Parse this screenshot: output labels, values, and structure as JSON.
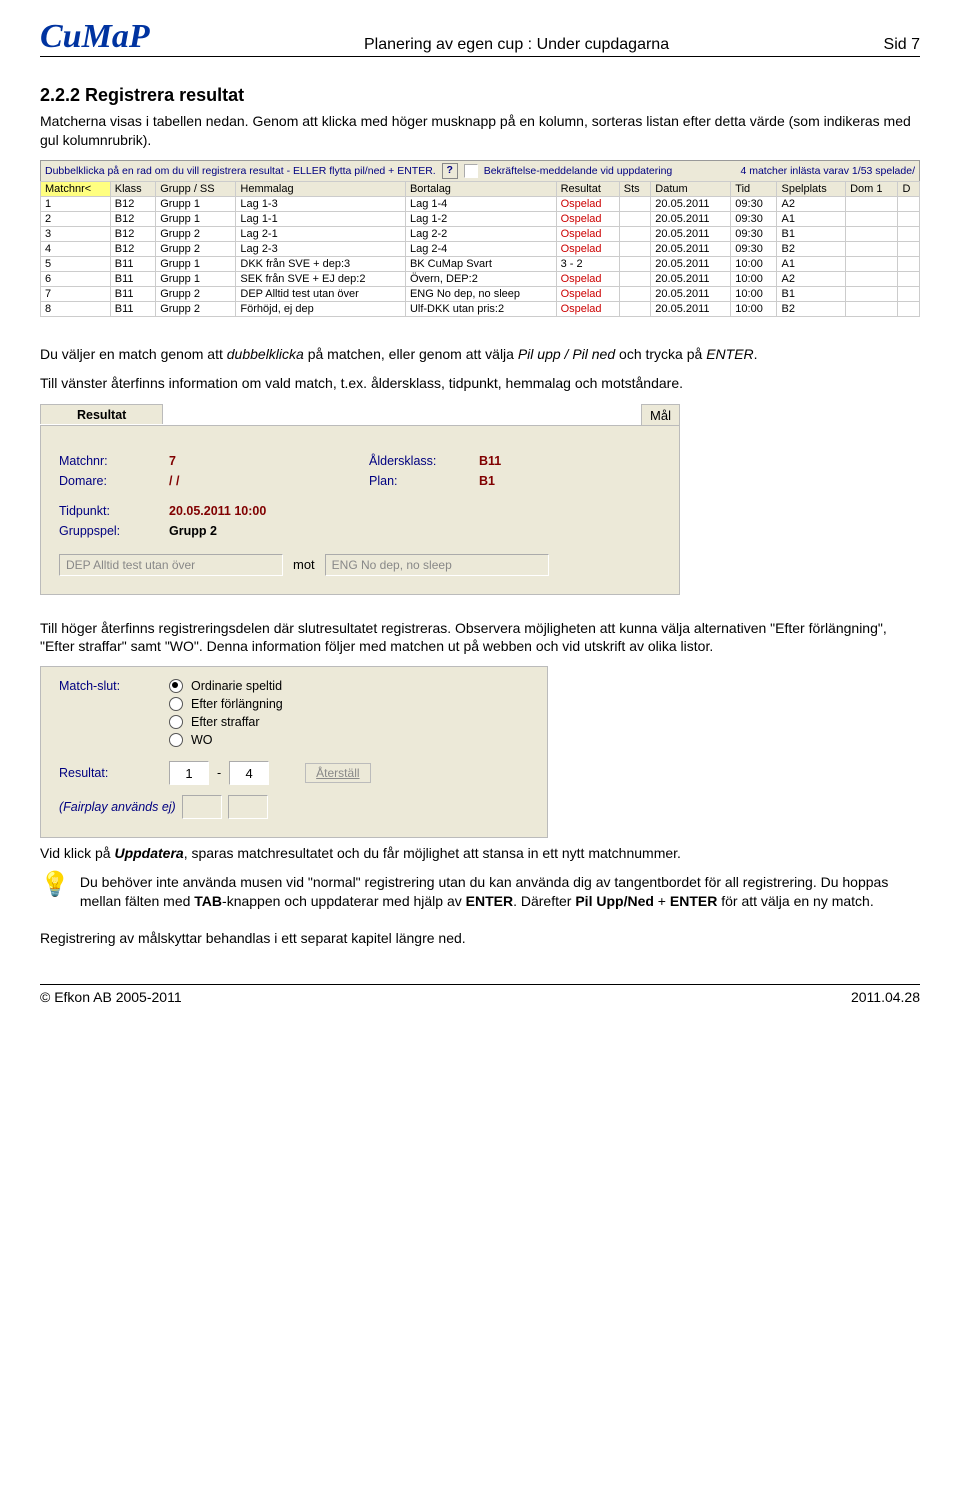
{
  "header": {
    "logo_text": "CuMaP",
    "center": "Planering av egen cup : Under cupdagarna",
    "page": "Sid 7"
  },
  "section": {
    "heading": "2.2.2 Registrera resultat",
    "intro": "Matcherna visas i tabellen nedan. Genom att klicka med höger musknapp på en kolumn, sorteras listan efter detta värde (som indikeras med gul kolumnrubrik)."
  },
  "table_hint": {
    "left": "Dubbelklicka på en rad om du vill registrera resultat - ELLER flytta pil/ned + ENTER.",
    "checkbox_label": "Bekräftelse-meddelande vid uppdatering",
    "right": "4 matcher inlästa varav 1/53 spelade/"
  },
  "table": {
    "columns": [
      "Matchnr<",
      "Klass",
      "Grupp / SS",
      "Hemmalag",
      "Bortalag",
      "Resultat",
      "Sts",
      "Datum",
      "Tid",
      "Spelplats",
      "Dom 1",
      "D"
    ],
    "rows": [
      {
        "nr": "1",
        "klass": "B12",
        "grupp": "Grupp 1",
        "hem": "Lag 1-3",
        "bort": "Lag 1-4",
        "res": "Ospelad",
        "sts": "",
        "datum": "20.05.2011",
        "tid": "09:30",
        "plats": "A2",
        "d1": "",
        "d2": ""
      },
      {
        "nr": "2",
        "klass": "B12",
        "grupp": "Grupp 1",
        "hem": "Lag 1-1",
        "bort": "Lag 1-2",
        "res": "Ospelad",
        "sts": "",
        "datum": "20.05.2011",
        "tid": "09:30",
        "plats": "A1",
        "d1": "",
        "d2": ""
      },
      {
        "nr": "3",
        "klass": "B12",
        "grupp": "Grupp 2",
        "hem": "Lag 2-1",
        "bort": "Lag 2-2",
        "res": "Ospelad",
        "sts": "",
        "datum": "20.05.2011",
        "tid": "09:30",
        "plats": "B1",
        "d1": "",
        "d2": ""
      },
      {
        "nr": "4",
        "klass": "B12",
        "grupp": "Grupp 2",
        "hem": "Lag 2-3",
        "bort": "Lag 2-4",
        "res": "Ospelad",
        "sts": "",
        "datum": "20.05.2011",
        "tid": "09:30",
        "plats": "B2",
        "d1": "",
        "d2": ""
      },
      {
        "nr": "5",
        "klass": "B11",
        "grupp": "Grupp 1",
        "hem": "DKK från SVE + dep:3",
        "bort": "BK CuMap Svart",
        "res": "3 - 2",
        "sts": "",
        "datum": "20.05.2011",
        "tid": "10:00",
        "plats": "A1",
        "d1": "",
        "d2": ""
      },
      {
        "nr": "6",
        "klass": "B11",
        "grupp": "Grupp 1",
        "hem": "SEK från SVE + EJ dep:2",
        "bort": "Övern, DEP:2",
        "res": "Ospelad",
        "sts": "",
        "datum": "20.05.2011",
        "tid": "10:00",
        "plats": "A2",
        "d1": "",
        "d2": ""
      },
      {
        "nr": "7",
        "klass": "B11",
        "grupp": "Grupp 2",
        "hem": "DEP Alltid test utan över",
        "bort": "ENG No dep, no sleep",
        "res": "Ospelad",
        "sts": "",
        "datum": "20.05.2011",
        "tid": "10:00",
        "plats": "B1",
        "d1": "",
        "d2": ""
      },
      {
        "nr": "8",
        "klass": "B11",
        "grupp": "Grupp 2",
        "hem": "Förhöjd, ej dep",
        "bort": "Ulf-DKK utan pris:2",
        "res": "Ospelad",
        "sts": "",
        "datum": "20.05.2011",
        "tid": "10:00",
        "plats": "B2",
        "d1": "",
        "d2": ""
      }
    ]
  },
  "para1": "Du väljer en match genom att dubbelklicka på matchen, eller genom att välja Pil upp / Pil ned och trycka på ENTER.",
  "para2": "Till vänster återfinns information om vald match, t.ex. åldersklass, tidpunkt, hemmalag och motståndare.",
  "resultat_panel": {
    "tab_main": "Resultat",
    "tab_right": "Mål",
    "labels": {
      "matchnr": "Matchnr:",
      "domare": "Domare:",
      "aldersklass": "Åldersklass:",
      "plan": "Plan:",
      "tidpunkt": "Tidpunkt:",
      "gruppspel": "Gruppspel:"
    },
    "values": {
      "matchnr": "7",
      "domare": "/ /",
      "aldersklass": "B11",
      "plan": "B1",
      "tidpunkt": "20.05.2011 10:00",
      "gruppspel": "Grupp 2",
      "home_team": "DEP Alltid test utan över",
      "mot": "mot",
      "away_team": "ENG No dep, no sleep"
    }
  },
  "para3": "Till höger återfinns registreringsdelen där slutresultatet registreras. Observera möjligheten att kunna välja alternativen \"Efter förlängning\", \"Efter straffar\" samt \"WO\". Denna information följer med matchen ut på webben och vid utskrift av olika listor.",
  "matchslut_panel": {
    "label": "Match-slut:",
    "options": [
      "Ordinarie speltid",
      "Efter förlängning",
      "Efter straffar",
      "WO"
    ],
    "selected_index": 0,
    "result_label": "Resultat:",
    "home_score": "1",
    "away_score": "4",
    "dash": "-",
    "reset_label": "Återställ",
    "fairplay_label": "(Fairplay används ej)"
  },
  "para4": "Vid klick på Uppdatera, sparas matchresultatet och du får möjlighet att stansa in ett nytt matchnummer.",
  "tip": "Du behöver inte använda musen vid \"normal\" registrering utan du kan använda dig av tangentbordet för all registrering. Du hoppas mellan fälten med TAB-knappen och uppdaterar med hjälp av ENTER. Därefter Pil Upp/Ned + ENTER för att välja en ny match.",
  "para5": "Registrering av målskyttar behandlas i ett separat kapitel längre ned.",
  "footer": {
    "left": "© Efkon AB 2005-2011",
    "right": "2011.04.28"
  }
}
